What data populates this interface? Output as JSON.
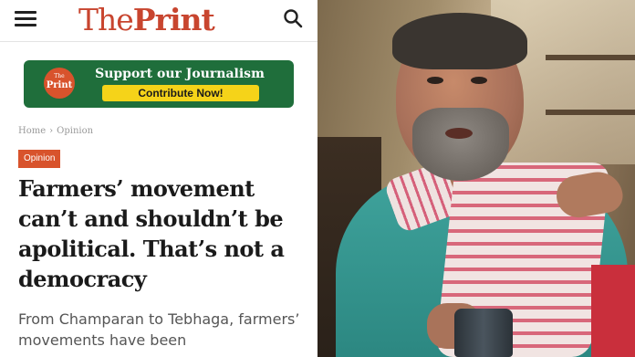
{
  "header": {
    "logo_the": "The",
    "logo_print": "Print",
    "menu_icon": "hamburger-menu-icon",
    "search_icon": "search-icon",
    "brand_color": "#c8452f"
  },
  "banner": {
    "badge_small": "The",
    "badge_big": "Print",
    "title": "Support our Journalism",
    "button_label": "Contribute Now!",
    "background": "#1f6e3b",
    "button_color": "#f5d319"
  },
  "breadcrumb": {
    "home": "Home",
    "separator": "›",
    "section": "Opinion"
  },
  "article": {
    "tag": "Opinion",
    "headline": "Farmers’ movement can’t and shouldn’t be apolitical. That’s not a democracy",
    "deck": "From Champaran to Tebhaga, farmers’ movements have been"
  },
  "photo": {
    "subject": "man in scarf holding a cup"
  }
}
